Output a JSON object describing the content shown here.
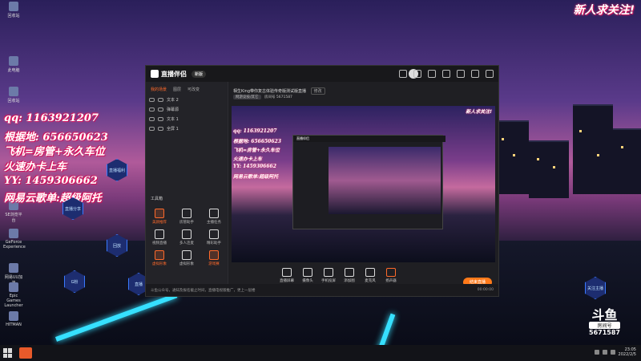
{
  "desktop": {
    "icons": [
      {
        "label": "回收站",
        "icon": "recycle-bin-icon"
      },
      {
        "label": "此电脑",
        "icon": "computer-icon"
      },
      {
        "label": "回收站",
        "icon": "folder-icon"
      },
      {
        "label": "SE浏览平台",
        "icon": "browser-icon"
      },
      {
        "label": "GeForce Experience",
        "icon": "geforce-icon"
      },
      {
        "label": "网易UU加速",
        "icon": "uu-icon"
      },
      {
        "label": "Epic Games Launcher",
        "icon": "epic-icon"
      },
      {
        "label": "HITMAN",
        "icon": "hitman-icon"
      }
    ],
    "overlay_lines": [
      "qq:  1163921207",
      "根据地:  656650623",
      "飞机=房管+永久车位",
      "火速办卡上车",
      "YY:  1459306662",
      "网易云歌单:超级阿托"
    ],
    "corner_title": "新人求关注!",
    "hex_buttons": [
      "直播福利",
      "直播分享",
      "回放",
      "G粉",
      "直播",
      "关注主播"
    ],
    "douyu": {
      "logo": "斗鱼",
      "room_label": "房间号",
      "room_id": "5671587"
    }
  },
  "app": {
    "name": "直播伴侣",
    "version": "新版",
    "sidebar": {
      "tabs": [
        "我的场景",
        "图层",
        "可改变"
      ],
      "active_tab": 0,
      "sources": [
        "文本 2",
        "弹幕源",
        "文本 1",
        "全屏 1"
      ],
      "tools_title": "工具箱",
      "tools": [
        {
          "label": "美颜推荐",
          "icon": "camera-icon",
          "hot": true
        },
        {
          "label": "房管助手",
          "icon": "user-icon",
          "hot": false
        },
        {
          "label": "主播任务",
          "icon": "task-icon",
          "hot": false
        },
        {
          "label": "视频直播",
          "icon": "video-icon",
          "hot": false
        },
        {
          "label": "多人连麦",
          "icon": "mic-group-icon",
          "hot": false
        },
        {
          "label": "精彩助手",
          "icon": "assist-icon",
          "hot": false
        },
        {
          "label": "虚拟形象",
          "icon": "avatar-icon",
          "hot": true
        },
        {
          "label": "虚拟形象",
          "icon": "avatar-alt-icon",
          "hot": false
        },
        {
          "label": "游戏赛",
          "icon": "game-icon",
          "hot": true
        }
      ]
    },
    "room": {
      "title": "相生King带你复古体验传奇版测试版直播",
      "edit_label": "修改",
      "tag": "网游竞技/其它",
      "meta": "房间号 5671587"
    },
    "controls": [
      {
        "label": "直播屏幕",
        "icon": "screen-icon"
      },
      {
        "label": "摄像头",
        "icon": "webcam-icon"
      },
      {
        "label": "手机投屏",
        "icon": "phone-icon"
      },
      {
        "label": "添加图",
        "icon": "image-icon"
      },
      {
        "label": "麦克风",
        "icon": "mic-icon"
      },
      {
        "label": "扬声器",
        "icon": "speaker-icon"
      }
    ],
    "go_live_label": "结束直播",
    "status_left": "斗鱼公众号，通知及报名截止时间，直播电视版推广，更上一层楼",
    "status_right": "00:00:00",
    "preview_overlay": [
      "qq: 1163921207",
      "根据地: 656650623",
      "飞机=房管+永久车位",
      "火速办卡上车",
      "YY: 1459306662",
      "网易云歌单:超级阿托"
    ],
    "preview_corner": "新人求关注!"
  },
  "taskbar": {
    "time": "23:05",
    "date": "2022/2/5"
  },
  "colors": {
    "accent": "#ff7a1a",
    "neon": "#36e0ff",
    "overlay_stroke": "#c0105a"
  }
}
